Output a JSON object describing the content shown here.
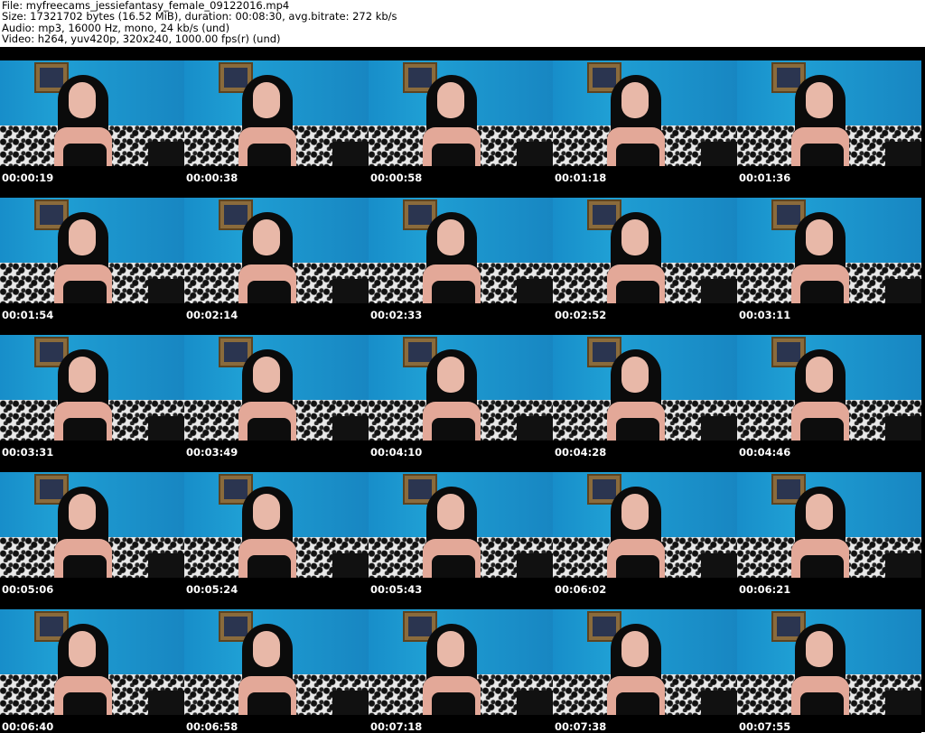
{
  "header": {
    "file": "File: myfreecams_jessiefantasy_female_09122016.mp4",
    "size": "Size: 17321702 bytes (16.52 MiB), duration: 00:08:30, avg.bitrate: 272 kb/s",
    "audio": "Audio: mp3, 16000 Hz, mono, 24 kb/s (und)",
    "video": "Video: h264, yuv420p, 320x240, 1000.00 fps(r) (und)"
  },
  "thumbnails": [
    "00:00:19",
    "00:00:38",
    "00:00:58",
    "00:01:18",
    "00:01:36",
    "00:01:54",
    "00:02:14",
    "00:02:33",
    "00:02:52",
    "00:03:11",
    "00:03:31",
    "00:03:49",
    "00:04:10",
    "00:04:28",
    "00:04:46",
    "00:05:06",
    "00:05:24",
    "00:05:43",
    "00:06:02",
    "00:06:21",
    "00:06:40",
    "00:06:58",
    "00:07:18",
    "00:07:38",
    "00:07:55"
  ],
  "colors": {
    "background": "#ffffff",
    "grid_background": "#000000",
    "wall": "#1f9fd4",
    "timestamp": "#ffffff"
  }
}
